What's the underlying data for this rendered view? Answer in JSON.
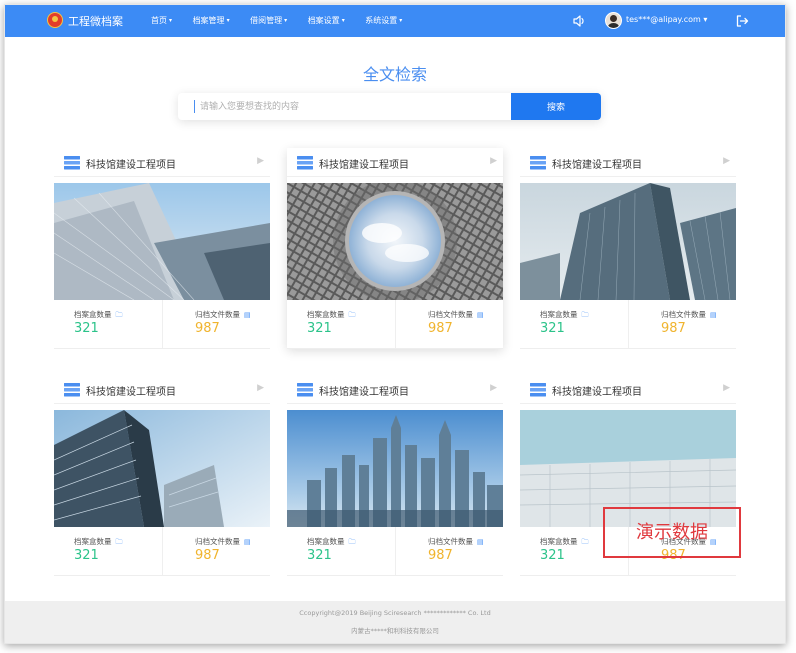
{
  "nav": {
    "app_title": "工程微档案",
    "menu": [
      {
        "label": "首页",
        "caret": "▾"
      },
      {
        "label": "档案管理",
        "caret": "▾"
      },
      {
        "label": "借阅管理",
        "caret": "▾"
      },
      {
        "label": "档案设置",
        "caret": "▾"
      },
      {
        "label": "系统设置",
        "caret": "▾"
      }
    ],
    "user_email": "tes***@alipay.com ▾"
  },
  "search": {
    "title": "全文检索",
    "placeholder": "请输入您要想查找的内容",
    "button_label": "搜索"
  },
  "cards": [
    {
      "title": "科技馆建设工程项目",
      "box_label": "档案盒数量",
      "box_count": "321",
      "file_label": "归档文件数量",
      "file_count": "987"
    },
    {
      "title": "科技馆建设工程项目",
      "box_label": "档案盒数量",
      "box_count": "321",
      "file_label": "归档文件数量",
      "file_count": "987"
    },
    {
      "title": "科技馆建设工程项目",
      "box_label": "档案盒数量",
      "box_count": "321",
      "file_label": "归档文件数量",
      "file_count": "987"
    },
    {
      "title": "科技馆建设工程项目",
      "box_label": "档案盒数量",
      "box_count": "321",
      "file_label": "归档文件数量",
      "file_count": "987"
    },
    {
      "title": "科技馆建设工程项目",
      "box_label": "档案盒数量",
      "box_count": "321",
      "file_label": "归档文件数量",
      "file_count": "987"
    },
    {
      "title": "科技馆建设工程项目",
      "box_label": "档案盒数量",
      "box_count": "321",
      "file_label": "归档文件数量",
      "file_count": "987"
    }
  ],
  "footer": {
    "line1": "Ccopyright@2019 Beijing Sciresearch ************* Co. Ltd",
    "line2": "内蒙古*****和利科技有限公司"
  },
  "stamp": {
    "text": "演示数据"
  },
  "colors": {
    "nav_bg": "#3c8bf5",
    "accent": "#1f78f0",
    "box_count": "#2cc38a",
    "file_count": "#f0b42e",
    "stamp": "#e0393e"
  }
}
